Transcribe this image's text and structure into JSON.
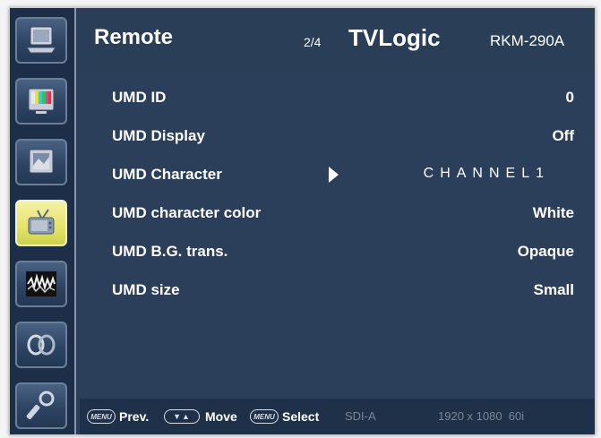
{
  "header": {
    "title": "Remote",
    "page": "2/4",
    "brand": "TVLogic",
    "model": "RKM-290A"
  },
  "sidebar": {
    "items": [
      {
        "icon": "monitor-icon"
      },
      {
        "icon": "color-bars-icon"
      },
      {
        "icon": "picture-icon"
      },
      {
        "icon": "remote-tv-icon",
        "active": true
      },
      {
        "icon": "waveform-icon"
      },
      {
        "icon": "link-icon"
      },
      {
        "icon": "tools-icon"
      }
    ]
  },
  "menu": {
    "rows": [
      {
        "label": "UMD ID",
        "value": "0"
      },
      {
        "label": "UMD Display",
        "value": "Off"
      },
      {
        "label": "UMD Character",
        "value": "CHANNEL1"
      },
      {
        "label": "UMD character color",
        "value": "White"
      },
      {
        "label": "UMD B.G. trans.",
        "value": "Opaque"
      },
      {
        "label": "UMD size",
        "value": "Small"
      }
    ]
  },
  "footer": {
    "menu_key": "MENU",
    "prev": "Prev.",
    "arrows_key": "▼▲",
    "move": "Move",
    "menu_key2": "MENU",
    "select": "Select",
    "input": "SDI-A",
    "format": "1920 x 1080  60i"
  },
  "colors": {
    "panel": "#2b3f5a",
    "active_tab": "#e5e36a",
    "text": "#ffffff"
  }
}
